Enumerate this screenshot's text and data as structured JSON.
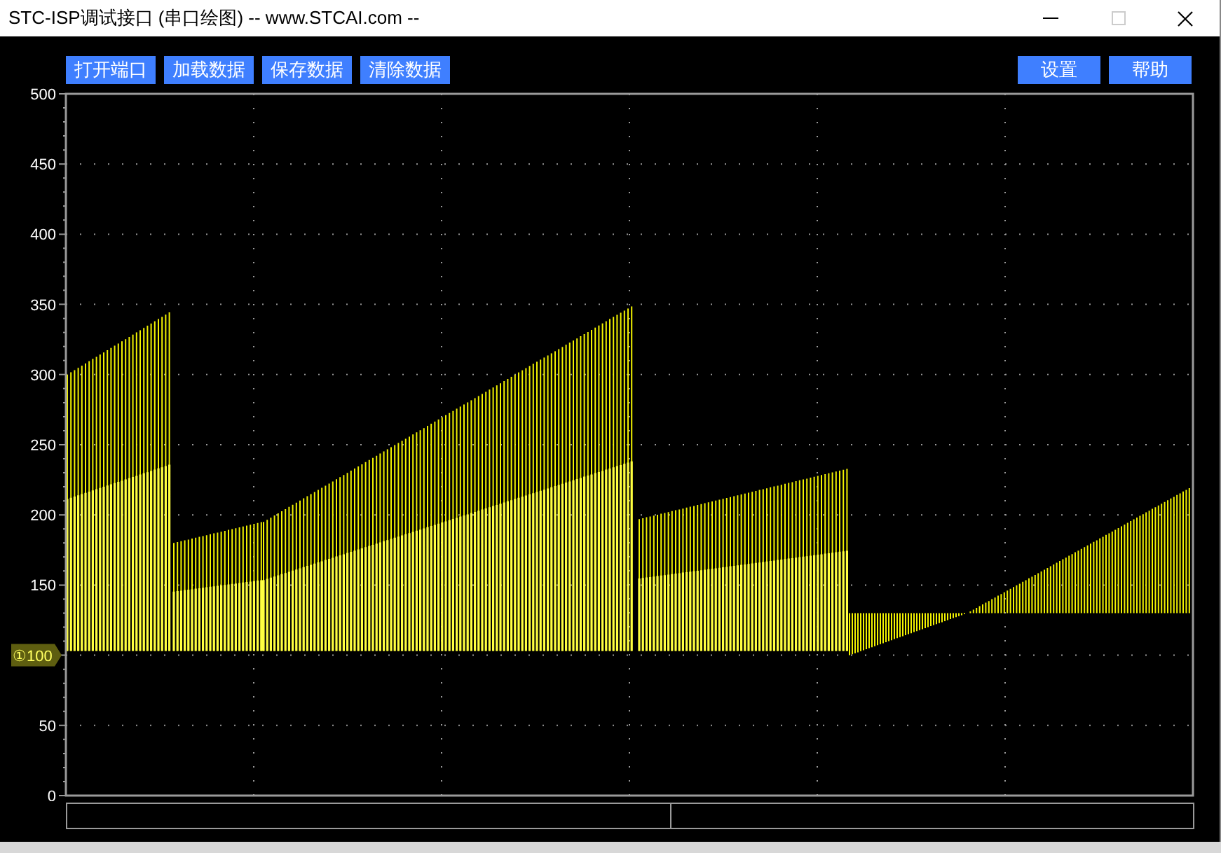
{
  "window": {
    "title": "STC-ISP调试接口 (串口绘图) -- www.STCAI.com --"
  },
  "toolbar": {
    "left_buttons": [
      "打开端口",
      "加载数据",
      "保存数据",
      "清除数据"
    ],
    "right_buttons": [
      "设置",
      "帮助"
    ]
  },
  "plot": {
    "y_axis_labels": [
      "500",
      "450",
      "400",
      "350",
      "300",
      "250",
      "200",
      "150",
      {
        "kind": "marker",
        "label": "①100"
      },
      "50",
      "0"
    ]
  }
}
